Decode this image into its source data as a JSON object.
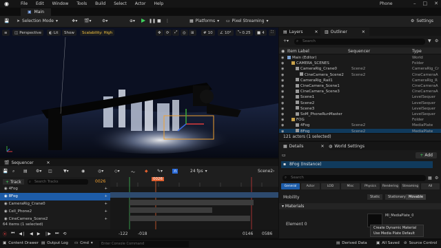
{
  "menubar": {
    "items": [
      "File",
      "Edit",
      "Window",
      "Tools",
      "Build",
      "Select",
      "Actor",
      "Help"
    ],
    "right_label": "Phone"
  },
  "tabs": {
    "main": "Main"
  },
  "toolbar": {
    "selection_mode": "Selection Mode",
    "platforms": "Platforms",
    "pixel_streaming": "Pixel Streaming",
    "settings": "Settings"
  },
  "viewport": {
    "perspective": "Perspective",
    "lit": "Lit",
    "show": "Show",
    "scalability": "Scalability: High",
    "grid_snap": "10",
    "angle_snap": "10°",
    "scale_snap": "0.25",
    "camera_speed": "4"
  },
  "layers_tabs": {
    "layers": "Layers",
    "outliner": "Outliner"
  },
  "outliner": {
    "search_placeholder": "Search",
    "col_label": "Item Label",
    "col_sequencer": "Sequencer",
    "col_type": "Type",
    "rows": [
      {
        "label": "Main (Editor)",
        "seq": "",
        "type": "World",
        "indent": 0,
        "sel": false
      },
      {
        "label": "CAMERA_SCENES",
        "seq": "",
        "type": "Folder",
        "indent": 1,
        "sel": false
      },
      {
        "label": "CameraRig_Crane0",
        "seq": "Scene2",
        "type": "CameraRig_Cr",
        "indent": 2,
        "sel": false
      },
      {
        "label": "CineCamera_Scene2",
        "seq": "Scene2",
        "type": "CineCameraA",
        "indent": 3,
        "sel": false
      },
      {
        "label": "CameraRig_Rail1",
        "seq": "",
        "type": "CameraRig_R",
        "indent": 2,
        "sel": false
      },
      {
        "label": "CineCamera_Scene1",
        "seq": "",
        "type": "CineCameraA",
        "indent": 2,
        "sel": false
      },
      {
        "label": "CineCamera_Scene3",
        "seq": "",
        "type": "CineCameraA",
        "indent": 2,
        "sel": false
      },
      {
        "label": "Scene1",
        "seq": "",
        "type": "LevelSequer",
        "indent": 2,
        "sel": false
      },
      {
        "label": "Scene2",
        "seq": "",
        "type": "LevelSequer",
        "indent": 2,
        "sel": false
      },
      {
        "label": "Scene3",
        "seq": "",
        "type": "LevelSequer",
        "indent": 2,
        "sel": false
      },
      {
        "label": "SoM_PhoneRunMaster",
        "seq": "",
        "type": "LevelSequer",
        "indent": 2,
        "sel": false
      },
      {
        "label": "FOG",
        "seq": "",
        "type": "Folder",
        "indent": 1,
        "sel": false
      },
      {
        "label": "4Fog",
        "seq": "Scene2",
        "type": "MediaPlate",
        "indent": 2,
        "sel": false
      },
      {
        "label": "8Fog",
        "seq": "Scene2",
        "type": "MediaPlate",
        "indent": 2,
        "sel": true
      }
    ],
    "status": "121 actors (1 selected)"
  },
  "details_tabs": {
    "details": "Details",
    "world_settings": "World Settings"
  },
  "details": {
    "add_label": "Add",
    "instance": "8Fog (Instance)",
    "search_placeholder": "Search",
    "filters": [
      "General",
      "Actor",
      "LOD",
      "Misc",
      "Physics",
      "Rendering",
      "Streaming",
      "All"
    ],
    "mobility_label": "Mobility",
    "mobility_options": [
      "Static",
      "Stationary",
      "Movable"
    ],
    "materials_label": "Materials",
    "element_label": "Element 0",
    "material_name": "MI_MediaPlate_0",
    "context_menu": [
      "Create Dynamic Material",
      "Use Media Plate Default"
    ]
  },
  "sequencer": {
    "tab": "Sequencer",
    "fps": "24 fps",
    "sequence_name": "Scene2",
    "track_add": "Track",
    "track_search_placeholder": "Search Tracks",
    "current_frame": "0026",
    "playhead_label": "0026",
    "tracks": [
      {
        "label": "4Fog",
        "sel": false
      },
      {
        "label": "8Fog",
        "sel": true
      },
      {
        "label": "CameraRig_Crane0",
        "sel": false
      },
      {
        "label": "Cell_Phone2",
        "sel": false
      },
      {
        "label": "CineCamera_Scene2",
        "sel": false
      }
    ],
    "item_count": "64 items (1 selected)",
    "range_start": "-122",
    "range_in": "-018",
    "range_out": "0146",
    "range_end": "0586"
  },
  "bottombar": {
    "content_drawer": "Content Drawer",
    "output_log": "Output Log",
    "cmd": "Cmd",
    "console_placeholder": "Enter Console Command",
    "derived_data": "Derived Data",
    "all_saved": "All Saved",
    "source_control": "Source Control"
  }
}
